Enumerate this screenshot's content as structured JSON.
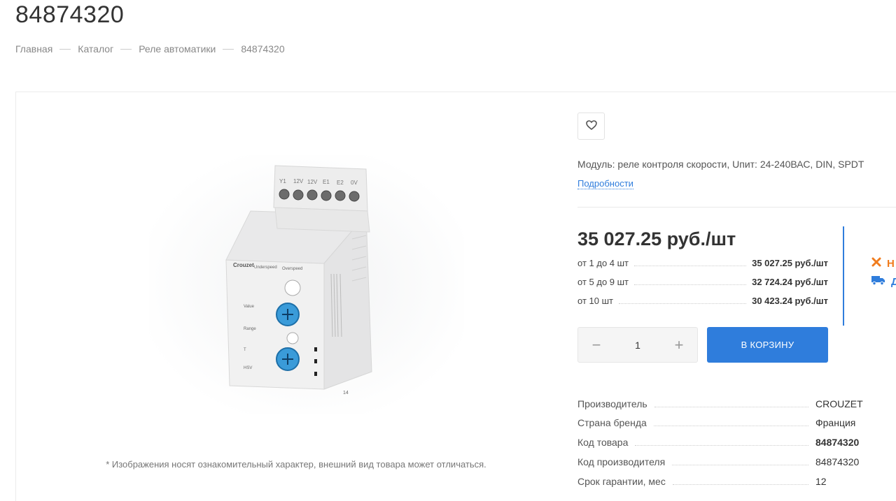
{
  "page": {
    "title": "84874320"
  },
  "breadcrumb": {
    "items": [
      "Главная",
      "Каталог",
      "Реле автоматики",
      "84874320"
    ]
  },
  "product": {
    "image_note": "* Изображения носят ознакомительный характер, внешний вид товара может отличаться.",
    "short_description": "Модуль: реле контроля скорости, Uпит: 24-240ВАС, DIN, SPDT",
    "details_link": "Подробности",
    "price_main": "35 027.25 руб./шт",
    "price_tiers": [
      {
        "label": "от 1 до 4 шт",
        "value": "35 027.25 руб./шт"
      },
      {
        "label": "от 5 до 9 шт",
        "value": "32 724.24 руб./шт"
      },
      {
        "label": "от 10 шт",
        "value": "30 423.24 руб./шт"
      }
    ],
    "status": {
      "availability": "Н",
      "delivery": "Д"
    },
    "quantity": {
      "value": "1",
      "minus": "−",
      "plus": "+"
    },
    "cart_button": "В КОРЗИНУ",
    "specs": [
      {
        "label": "Производитель",
        "value": "CROUZET"
      },
      {
        "label": "Страна бренда",
        "value": "Франция"
      },
      {
        "label": "Код товара",
        "value": "84874320"
      },
      {
        "label": "Код производителя",
        "value": "84874320"
      },
      {
        "label": "Срок гарантии, мес",
        "value": "12"
      }
    ],
    "image_labels": {
      "brand": "Crouzet",
      "underspeed": "Underspeed",
      "overspeed": "Overspeed",
      "value": "Value",
      "range": "Range",
      "t": "T",
      "model": "HSV",
      "terminals": [
        "Y1",
        "12V",
        "12V",
        "E1",
        "E2",
        "0V"
      ],
      "bottom_terminal": "14"
    }
  },
  "colors": {
    "accent": "#2f7ddc",
    "warning": "#f07c1e",
    "text": "#333333"
  }
}
